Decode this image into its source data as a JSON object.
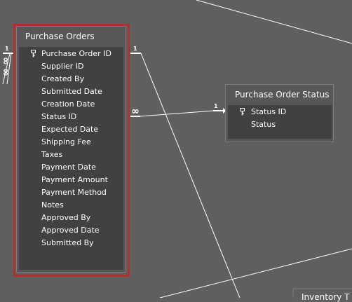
{
  "tables": {
    "purchase_orders": {
      "title": "Purchase Orders",
      "fields": [
        "Purchase Order ID",
        "Supplier ID",
        "Created By",
        "Submitted Date",
        "Creation Date",
        "Status ID",
        "Expected Date",
        "Shipping Fee",
        "Taxes",
        "Payment Date",
        "Payment Amount",
        "Payment Method",
        "Notes",
        "Approved By",
        "Approved Date",
        "Submitted By"
      ],
      "primary_key": "Purchase Order ID",
      "selected": true
    },
    "purchase_order_status": {
      "title": "Purchase Order Status",
      "fields": [
        "Status ID",
        "Status"
      ],
      "primary_key": "Status ID"
    },
    "partial_table": {
      "title": "Inventory T"
    }
  },
  "relationships": [
    {
      "from": "Purchase Orders.Status ID",
      "to": "Purchase Order Status.Status ID",
      "from_cardinality": "∞",
      "to_cardinality": "1"
    },
    {
      "from": "Purchase Orders.Purchase Order ID",
      "to": "offscreen",
      "from_cardinality": "1"
    },
    {
      "from": "offscreen-left",
      "to": "Purchase Orders.Purchase Order ID",
      "to_cardinality": "1",
      "from_cardinality": "∞"
    }
  ],
  "colors": {
    "background": "#5f5f5f",
    "table_bg": "#575757",
    "fields_bg": "#414141",
    "selection": "#b03030",
    "text": "#ffffff"
  }
}
